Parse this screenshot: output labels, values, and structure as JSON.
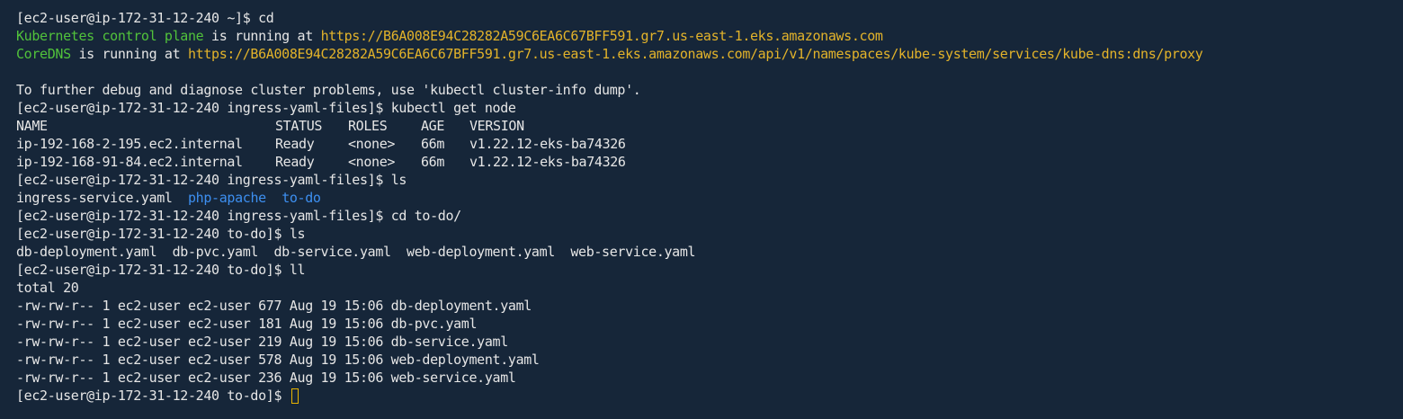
{
  "terminal": {
    "prompt_home": "[ec2-user@ip-172-31-12-240 ~]$ ",
    "prompt_ingress": "[ec2-user@ip-172-31-12-240 ingress-yaml-files]$ ",
    "prompt_todo": "[ec2-user@ip-172-31-12-240 to-do]$ ",
    "cmd_cd": "cd",
    "cmd_get_node": "kubectl get node",
    "cmd_ls": "ls",
    "cmd_cd_todo": "cd to-do/",
    "cmd_ll": "ll",
    "cluster_info": {
      "cp_name": "Kubernetes control plane",
      "is_running_at": " is running at ",
      "cp_url": "https://B6A008E94C28282A59C6EA6C67BFF591.gr7.us-east-1.eks.amazonaws.com",
      "dns_name": "CoreDNS",
      "dns_url": "https://B6A008E94C28282A59C6EA6C67BFF591.gr7.us-east-1.eks.amazonaws.com/api/v1/namespaces/kube-system/services/kube-dns:dns/proxy",
      "debug_hint": "To further debug and diagnose cluster problems, use 'kubectl cluster-info dump'."
    },
    "nodes": {
      "headers": [
        "NAME",
        "STATUS",
        "ROLES",
        "AGE",
        "VERSION"
      ],
      "rows": [
        [
          "ip-192-168-2-195.ec2.internal",
          "Ready",
          "<none>",
          "66m",
          "v1.22.12-eks-ba74326"
        ],
        [
          "ip-192-168-91-84.ec2.internal",
          "Ready",
          "<none>",
          "66m",
          "v1.22.12-eks-ba74326"
        ]
      ]
    },
    "ls_ingress": {
      "file1": "ingress-service.yaml",
      "dir1": "php-apache",
      "dir2": "to-do"
    },
    "ls_todo": "db-deployment.yaml  db-pvc.yaml  db-service.yaml  web-deployment.yaml  web-service.yaml",
    "ll_total": "total 20",
    "ll_rows": [
      "-rw-rw-r-- 1 ec2-user ec2-user 677 Aug 19 15:06 db-deployment.yaml",
      "-rw-rw-r-- 1 ec2-user ec2-user 181 Aug 19 15:06 db-pvc.yaml",
      "-rw-rw-r-- 1 ec2-user ec2-user 219 Aug 19 15:06 db-service.yaml",
      "-rw-rw-r-- 1 ec2-user ec2-user 578 Aug 19 15:06 web-deployment.yaml",
      "-rw-rw-r-- 1 ec2-user ec2-user 236 Aug 19 15:06 web-service.yaml"
    ]
  },
  "colors": {
    "background": "#162639",
    "text": "#e6e6e6",
    "green": "#51c23b",
    "yellow": "#e3b32a",
    "blue": "#3d8ff0",
    "cursor": "#e8b400"
  }
}
